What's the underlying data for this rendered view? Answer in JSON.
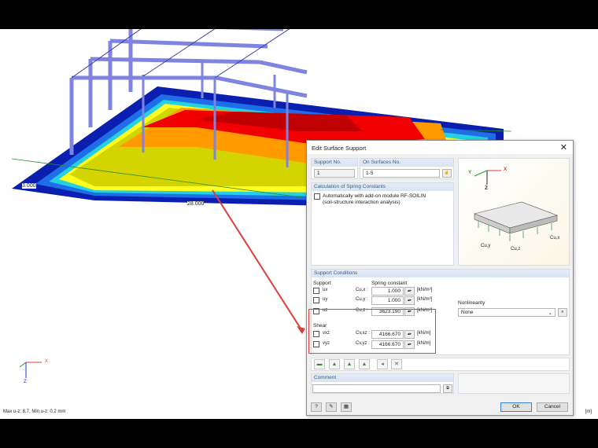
{
  "viewport": {
    "dimension_left": "3.000",
    "dimension_bottom": "28.000",
    "status": "Max u-z: 8.7, Min u-z: 0.2 mm",
    "unit": "[m]",
    "axes": {
      "x": "X",
      "y": "Y",
      "z": "Z"
    }
  },
  "dialog": {
    "title": "Edit Surface Support",
    "support_no_label": "Support No.",
    "support_no": "1",
    "on_surfaces_label": "On Surfaces No.",
    "on_surfaces": "1-5",
    "calc_header": "Calculation of Spring Constants",
    "calc_checkbox_line1": "Automatically with add-on module RF-SOILIN",
    "calc_checkbox_line2": "(soil-structure interaction analysis)",
    "calc_checked": false,
    "figure_labels": {
      "x": "X",
      "y": "Y",
      "z": "Z",
      "cux": "Cu,x",
      "cuy": "Cu,y",
      "cuz": "Cu,z"
    },
    "conditions_header": "Support Conditions",
    "support_label": "Support",
    "spring_label": "Spring constant",
    "shear_label": "Shear",
    "rows": [
      {
        "dof": "ux",
        "const": "Cu,x :",
        "value": "1.000",
        "unit": "[kN/m³]",
        "checked": false
      },
      {
        "dof": "uy",
        "const": "Cu,y :",
        "value": "1.000",
        "unit": "[kN/m³]",
        "checked": false
      },
      {
        "dof": "uz",
        "const": "Cu,z :",
        "value": "3623.190",
        "unit": "[kN/m³]",
        "checked": false
      },
      {
        "dof": "vxz",
        "const": "Cv,xz :",
        "value": "4166.670",
        "unit": "[kN/m]",
        "checked": false
      },
      {
        "dof": "vyz",
        "const": "Cv,yz :",
        "value": "4166.670",
        "unit": "[kN/m]",
        "checked": false
      }
    ],
    "nonlinearity_label": "Nonlinearity",
    "nonlinearity": "None",
    "comment_label": "Comment",
    "comment": "",
    "ok": "OK",
    "cancel": "Cancel",
    "highlight_color": "#e03c3c"
  }
}
